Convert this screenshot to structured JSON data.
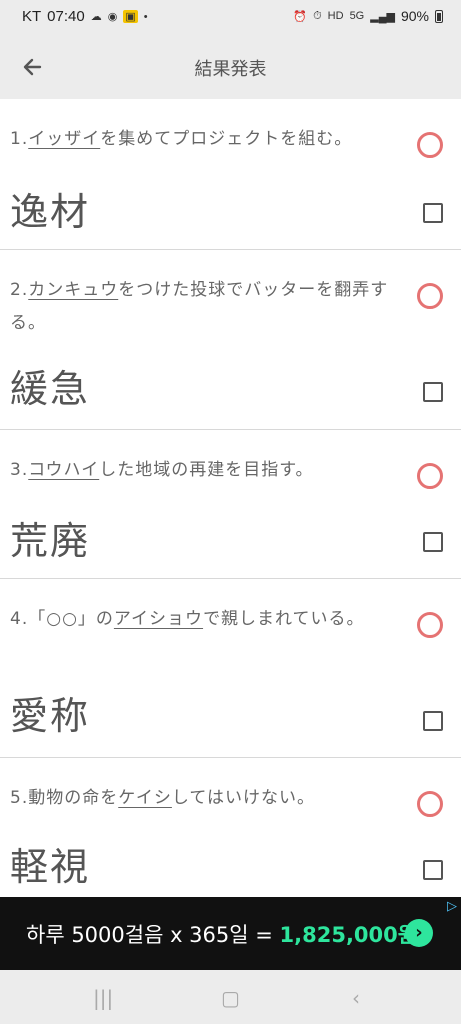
{
  "status": {
    "carrier": "KT",
    "time": "07:40",
    "battery": "90%"
  },
  "appbar": {
    "title": "結果発表"
  },
  "items": [
    {
      "num": "1.",
      "kana": "イッザイ",
      "rest": "を集めてプロジェクトを組む。",
      "answer": "逸材"
    },
    {
      "num": "2.",
      "kana": "カンキュウ",
      "rest": "をつけた投球でバッターを翻弄する。",
      "answer": "緩急"
    },
    {
      "num": "3.",
      "kana": "コウハイ",
      "rest": "した地域の再建を目指す。",
      "answer": "荒廃"
    },
    {
      "num": "4.",
      "pre": "「○○」の",
      "kana": "アイショウ",
      "rest": "で親しまれている。",
      "answer": "愛称"
    },
    {
      "num": "5.",
      "kana": "ケイシ",
      "rest": "してはいけない。",
      "answer": "軽視",
      "pre": "動物の命を"
    }
  ],
  "ad": {
    "text_prefix": "하루 5000걸음 x 365일 = ",
    "highlight": "1,825,000원",
    "button_icon": "chevron-right-icon",
    "tag_icon": "adchoices-icon",
    "accent": "#2ee59d"
  },
  "nav": {
    "recent_icon": "recent-apps-icon",
    "home_icon": "home-icon",
    "back_icon": "back-icon"
  }
}
